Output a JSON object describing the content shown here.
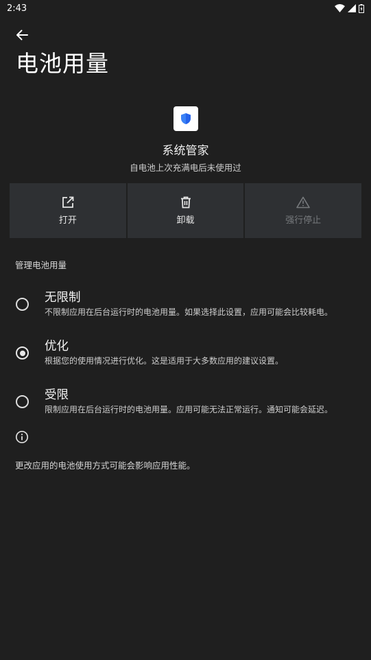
{
  "status_bar": {
    "time": "2:43",
    "icons": [
      "wifi-icon",
      "signal-icon",
      "battery-icon"
    ]
  },
  "header": {
    "back_icon": "arrow-left-icon",
    "title": "电池用量"
  },
  "app": {
    "icon": "shield-icon",
    "name": "系统管家",
    "subtitle": "自电池上次充满电后未使用过"
  },
  "actions": [
    {
      "label": "打开",
      "icon": "open-external-icon",
      "enabled": true
    },
    {
      "label": "卸载",
      "icon": "trash-icon",
      "enabled": true
    },
    {
      "label": "强行停止",
      "icon": "warning-icon",
      "enabled": false
    }
  ],
  "section": {
    "title": "管理电池用量"
  },
  "options": [
    {
      "title": "无限制",
      "description": "不限制应用在后台运行时的电池用量。如果选择此设置，应用可能会比较耗电。",
      "selected": false
    },
    {
      "title": "优化",
      "description": "根据您的使用情况进行优化。这是适用于大多数应用的建议设置。",
      "selected": true
    },
    {
      "title": "受限",
      "description": "限制应用在后台运行时的电池用量。应用可能无法正常运行。通知可能会延迟。",
      "selected": false
    }
  ],
  "footer": {
    "icon": "info-icon",
    "note": "更改应用的电池使用方式可能会影响应用性能。"
  },
  "colors": {
    "background": "#1f1f1f",
    "button_bg": "#2e3033",
    "shield_blue": "#3b82f6"
  }
}
